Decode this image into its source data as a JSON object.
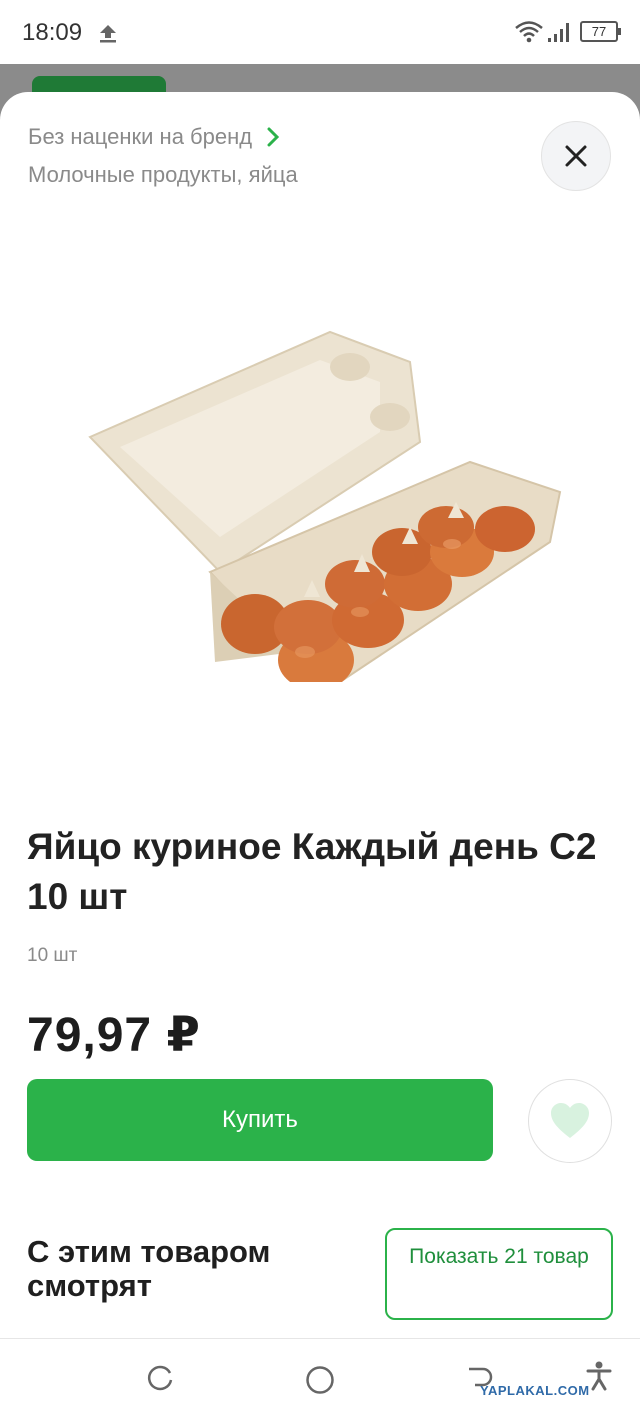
{
  "status_bar": {
    "time": "18:09",
    "battery": "77"
  },
  "sheet": {
    "brand_link": "Без наценки на бренд",
    "category": "Молочные продукты, яйца"
  },
  "product": {
    "title": "Яйцо куриное Каждый день С2 10 шт",
    "quantity": "10 шт",
    "price": "79,97 ₽",
    "buy_label": "Купить"
  },
  "related": {
    "title": "С этим товаром смотрят",
    "show_more_label": "Показать 21 товар"
  },
  "watermark": "YAPLAKAL.COM",
  "colors": {
    "accent": "#2bb24a",
    "favorite": "#d8f2df",
    "text_secondary": "#8a8a8a"
  },
  "icons": [
    "upload-icon",
    "wifi-icon",
    "signal-icon",
    "battery-icon",
    "chevron-right-icon",
    "close-icon",
    "heart-icon",
    "recents-icon",
    "home-icon",
    "back-icon",
    "accessibility-icon"
  ]
}
